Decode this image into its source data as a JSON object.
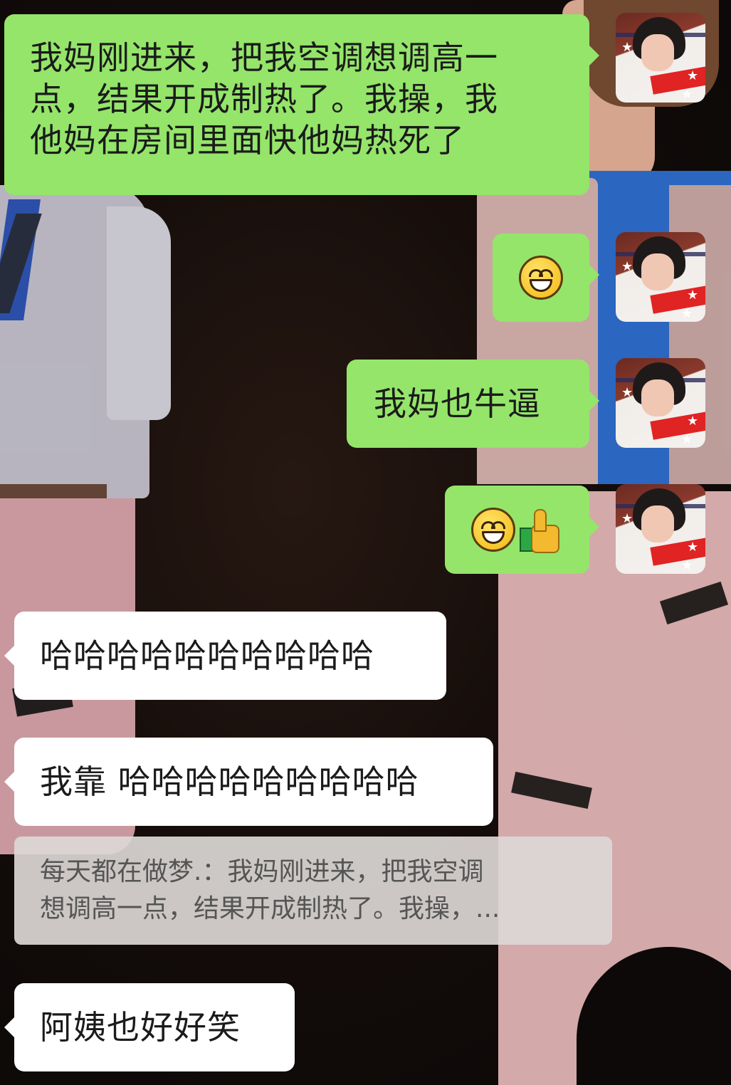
{
  "messages": [
    {
      "sender": "me",
      "type": "text",
      "text": [
        "我妈刚进来，把我空调想调高一",
        "点，结果开成制热了。我操，我",
        "他妈在房间里面快他妈热死了"
      ]
    },
    {
      "sender": "me",
      "type": "emoji",
      "emoji": [
        "grinning-face-emoji"
      ]
    },
    {
      "sender": "me",
      "type": "text",
      "text": [
        "我妈也牛逼"
      ]
    },
    {
      "sender": "me",
      "type": "emoji",
      "emoji": [
        "grinning-face-emoji",
        "thumbs-up-emoji"
      ]
    },
    {
      "sender": "other",
      "type": "text",
      "text": [
        "哈哈哈哈哈哈哈哈哈哈"
      ]
    },
    {
      "sender": "other",
      "type": "text",
      "text": [
        "我靠 哈哈哈哈哈哈哈哈哈"
      ]
    },
    {
      "sender": "other",
      "type": "text",
      "text": [
        "阿姨也好好笑"
      ]
    }
  ],
  "quote": {
    "lines": [
      "每天都在做梦.：我妈刚进来，把我空调",
      "想调高一点，结果开成制热了。我操，..."
    ]
  },
  "colors": {
    "my_bubble": "#94e56a",
    "other_bubble": "#ffffff",
    "quote_bg": "#dcd8d6"
  }
}
